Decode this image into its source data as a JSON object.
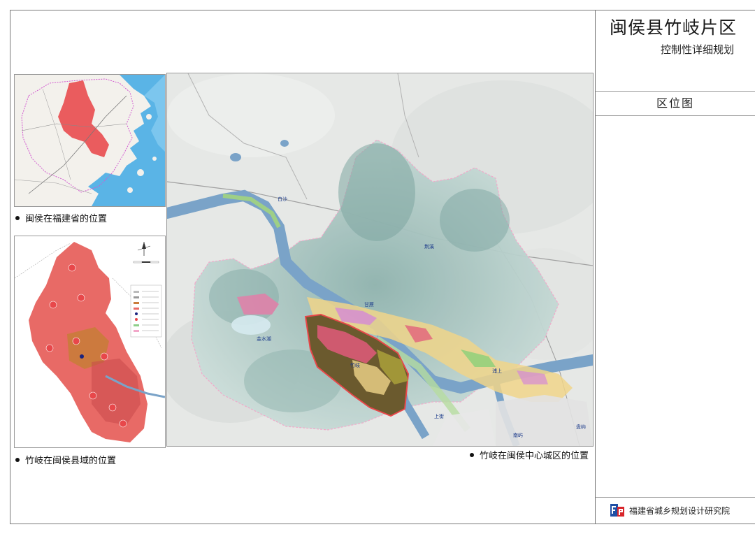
{
  "title": {
    "main": "闽侯县竹岐片区",
    "sub": "控制性详细规划"
  },
  "sheet_name": "区位图",
  "organization": "福建省城乡规划设计研究院",
  "panels": {
    "province": {
      "caption": "闽侯在福建省的位置"
    },
    "county": {
      "caption": "竹岐在闽侯县域的位置"
    },
    "city": {
      "caption": "竹岐在闽侯中心城区的位置",
      "place_labels": [
        "白沙",
        "甘蔗",
        "金水湖",
        "竹岐",
        "荆溪",
        "上街",
        "南屿",
        "浦上",
        "盘屿"
      ]
    }
  },
  "colors": {
    "sea": "#5ab4e6",
    "province_land": "#f3f1ec",
    "highlight_red": "#e8474a",
    "county_fill": "#e86a66",
    "county_dark": "#c9494a",
    "core_orange": "#c97c3a",
    "river": "#7aa3c8",
    "terrain_light": "#e8ece8",
    "terrain_green": "#a9c5c2",
    "boundary_pink": "#f2a7c9",
    "site_dark": "#6b5a2e"
  }
}
